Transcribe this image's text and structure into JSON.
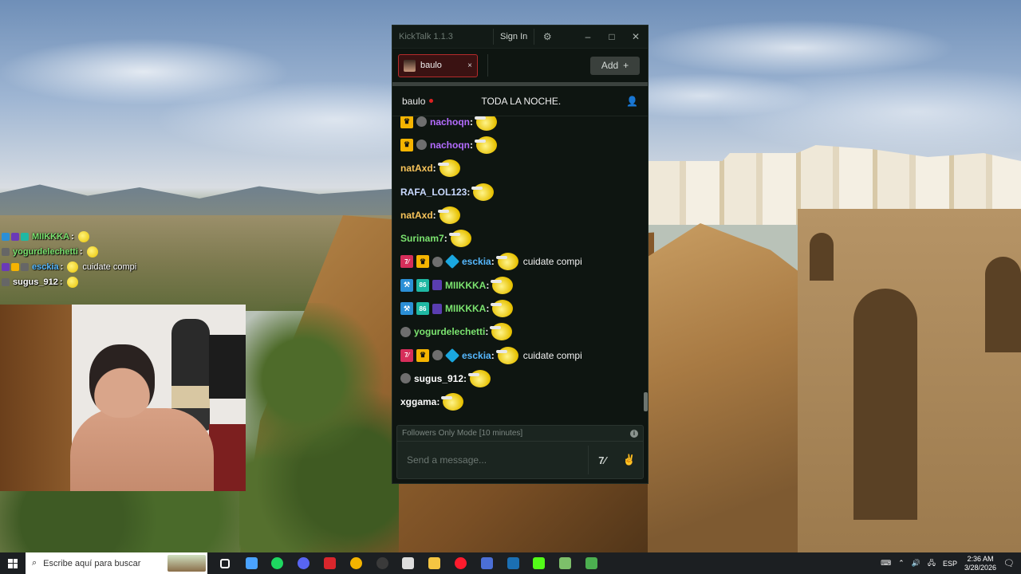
{
  "overlay_chat": [
    {
      "user": "MIIKKKA",
      "user_color": "#7be36f",
      "message": "",
      "badges": [
        "#2b8fd6",
        "#6a3ab8",
        "#1fb8a3"
      ]
    },
    {
      "user": "yogurdelechetti",
      "user_color": "#7be36f",
      "message": "",
      "badges": [
        "#666666"
      ]
    },
    {
      "user": "esckia",
      "user_color": "#56b8ff",
      "message": "cuidate compi",
      "badges": [
        "#6a3ab8",
        "#f5b400",
        "#666666"
      ]
    },
    {
      "user": "sugus_912",
      "user_color": "#ffffff",
      "message": "",
      "badges": [
        "#666666"
      ]
    }
  ],
  "kicktalk": {
    "title": "KickTalk 1.1.3",
    "signin_label": "Sign In",
    "tab": {
      "label": "baulo",
      "close": "×"
    },
    "add_label": "Add",
    "add_icon": "+",
    "channel": {
      "name": "baulo",
      "stream_title": "TODA LA NOCHE."
    },
    "messages": [
      {
        "user": "nachoqn",
        "color": "#b46cff",
        "badges": [
          "crown",
          "og"
        ],
        "text": ""
      },
      {
        "user": "nachoqn",
        "color": "#b46cff",
        "badges": [
          "crown",
          "og"
        ],
        "text": ""
      },
      {
        "user": "natAxd",
        "color": "#f7c35a",
        "badges": [],
        "text": ""
      },
      {
        "user": "RAFA_LOL123",
        "color": "#c9d9ff",
        "badges": [],
        "text": ""
      },
      {
        "user": "natAxd",
        "color": "#f7c35a",
        "badges": [],
        "text": ""
      },
      {
        "user": "Surinam7",
        "color": "#7be36f",
        "badges": [],
        "text": ""
      },
      {
        "user": "esckia",
        "color": "#56b8ff",
        "badges": [
          "kickmod",
          "crown",
          "og",
          "sub"
        ],
        "text": "cuidate compi"
      },
      {
        "user": "MIIKKKA",
        "color": "#7be36f",
        "badges": [
          "mod",
          "founder",
          "vip"
        ],
        "text": ""
      },
      {
        "user": "MIIKKKA",
        "color": "#7be36f",
        "badges": [
          "mod",
          "founder",
          "vip"
        ],
        "text": ""
      },
      {
        "user": "yogurdelechetti",
        "color": "#7be36f",
        "badges": [
          "og"
        ],
        "text": ""
      },
      {
        "user": "esckia",
        "color": "#56b8ff",
        "badges": [
          "kickmod",
          "crown",
          "og",
          "sub"
        ],
        "text": "cuidate compi"
      },
      {
        "user": "sugus_912",
        "color": "#ffffff",
        "badges": [
          "og"
        ],
        "text": ""
      },
      {
        "user": "xggama",
        "color": "#ffffff",
        "badges": [],
        "text": ""
      }
    ],
    "mode_text": "Followers Only Mode [10 minutes]",
    "input_placeholder": "Send a message...",
    "accent_green": "#53fc18",
    "tab_border": "#b52b2b"
  },
  "taskbar": {
    "search_placeholder": "Escribe aquí para buscar",
    "language": "ESP",
    "time": "2:36 AM",
    "date": "3/28/2026",
    "apps": [
      {
        "name": "task-view",
        "color": "#ffffff"
      },
      {
        "name": "copilot",
        "color": "#4aa3ff"
      },
      {
        "name": "spotify",
        "color": "#1ed760"
      },
      {
        "name": "discord",
        "color": "#5865f2"
      },
      {
        "name": "voicemeeter",
        "color": "#d9262c"
      },
      {
        "name": "chrome",
        "color": "#f4b400"
      },
      {
        "name": "obs",
        "color": "#3a3a3a"
      },
      {
        "name": "app-dark",
        "color": "#dddddd"
      },
      {
        "name": "file-explorer",
        "color": "#f5c542"
      },
      {
        "name": "opera",
        "color": "#ff1b2d"
      },
      {
        "name": "app-blue",
        "color": "#4b6fd6"
      },
      {
        "name": "steam",
        "color": "#1b6fb3"
      },
      {
        "name": "kick",
        "color": "#53fc18"
      },
      {
        "name": "app-books",
        "color": "#7dbf6a"
      },
      {
        "name": "app-green-box",
        "color": "#4caf50"
      }
    ]
  }
}
